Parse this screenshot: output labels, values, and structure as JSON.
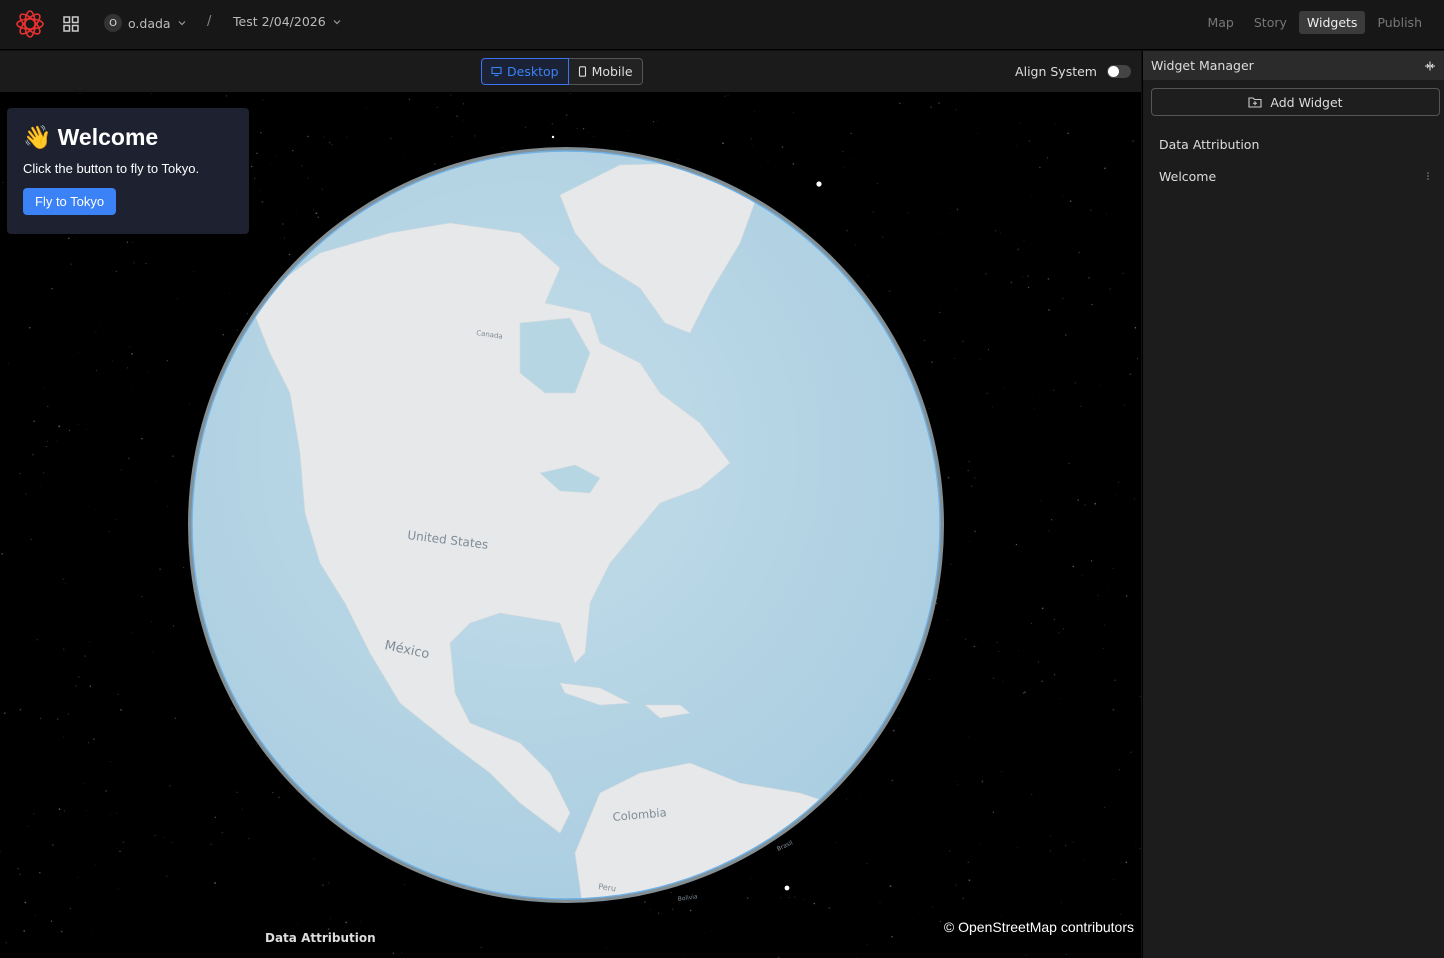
{
  "header": {
    "workspace_initial": "O",
    "workspace_name": "o.dada",
    "separator": "/",
    "project_name": "Test 2/04/2026",
    "tabs": [
      {
        "label": "Map"
      },
      {
        "label": "Story"
      },
      {
        "label": "Widgets"
      },
      {
        "label": "Publish"
      }
    ],
    "active_tab": "Widgets"
  },
  "viewport": {
    "desktop_label": "Desktop",
    "mobile_label": "Mobile",
    "align_label": "Align System",
    "align_enabled": false
  },
  "map": {
    "labels": [
      "Canada",
      "United States",
      "México",
      "Colombia",
      "Peru",
      "Bolivia",
      "Brasil"
    ],
    "attribution_widget_label": "Data Attribution",
    "osm_credit": "© OpenStreetMap contributors"
  },
  "welcome_widget": {
    "emoji": "👋",
    "title": "Welcome",
    "text": "Click the button to fly to Tokyo.",
    "button_label": "Fly to Tokyo"
  },
  "widget_manager": {
    "title": "Widget Manager",
    "add_label": "Add Widget",
    "items": [
      {
        "label": "Data Attribution"
      },
      {
        "label": "Welcome"
      }
    ]
  },
  "colors": {
    "accent": "#3b82f6",
    "ocean": "#b7d6e4",
    "land": "#e6e8ea",
    "logo": "#e8312f"
  }
}
